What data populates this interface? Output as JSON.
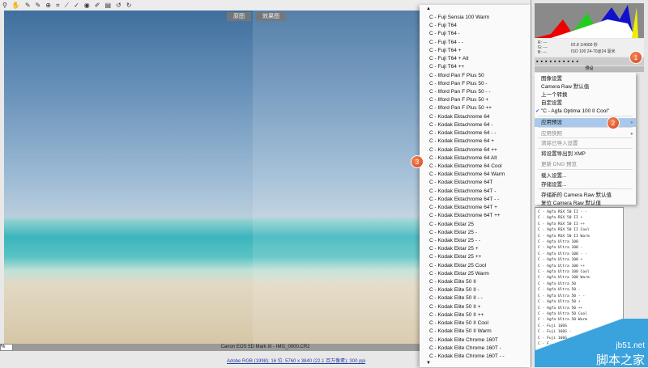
{
  "toolbar": {
    "icons": [
      "zoom-icon",
      "hand-icon",
      "white-balance-icon",
      "color-sampler-icon",
      "target-adjust-icon",
      "crop-icon",
      "straighten-icon",
      "spot-removal-icon",
      "red-eye-icon",
      "adjustment-brush-icon",
      "graduated-filter-icon",
      "rotate-left-icon",
      "rotate-right-icon"
    ]
  },
  "view_buttons": {
    "before": "原图",
    "after": "效果图"
  },
  "bottom": {
    "zoom": "%",
    "camera": "Canon EOS 5D Mark III - IMG_0000.CR2",
    "workflow_link": "Adobe RGB (1998); 16 位; 5760 x 3840 (22.1 百万像素); 300 ppi"
  },
  "info": {
    "r": "R: ---",
    "g": "G: ---",
    "b": "B: ---",
    "exposure": "f/2.8  1/4000 秒",
    "iso": "ISO 100  24-70@24 毫米"
  },
  "presets_header": "预设",
  "menu": {
    "items": [
      {
        "label": "图像设置",
        "disabled": false
      },
      {
        "label": "Camera Raw 默认值",
        "disabled": false
      },
      {
        "label": "上一个转换",
        "disabled": false
      },
      {
        "label": "自定设置",
        "disabled": false
      },
      {
        "label": "\"C - Agfa Optima 100 II Cool\"",
        "disabled": false,
        "checked": true
      },
      {
        "label": "应用预设",
        "highlighted": true,
        "submenu": true
      },
      {
        "label": "应用快照",
        "disabled": true,
        "submenu": true
      },
      {
        "label": "清除已导入设置",
        "disabled": true
      },
      {
        "label": "将设置导出到 XMP",
        "disabled": false
      },
      {
        "label": "更新 DNG 预览",
        "disabled": true
      },
      {
        "label": "载入设置...",
        "disabled": false
      },
      {
        "label": "存储设置...",
        "disabled": false
      },
      {
        "label": "存储新的 Camera Raw 默认值",
        "disabled": false
      },
      {
        "label": "复位 Camera Raw 默认值",
        "disabled": false
      }
    ]
  },
  "preset_list": [
    "C - Agfa RSX 50 II - -",
    "C - Agfa RSX 50 II +",
    "C - Agfa RSX 50 II ++",
    "C - Agfa RSX 50 II Cool",
    "C - Agfa RSX 50 II Warm",
    "C - Agfa Ultra 100",
    "C - Agfa Ultra 100 -",
    "C - Agfa Ultra 100 - -",
    "C - Agfa Ultra 100 +",
    "C - Agfa Ultra 100 ++",
    "C - Agfa Ultra 100 Cool",
    "C - Agfa Ultra 100 Warm",
    "C - Agfa Ultra 50",
    "C - Agfa Ultra 50 -",
    "C - Agfa Ultra 50 - -",
    "C - Agfa Ultra 50 +",
    "C - Agfa Ultra 50 ++",
    "C - Agfa Ultra 50 Cool",
    "C - Agfa Ultra 50 Warm",
    "C - Fuji 160S",
    "C - Fuji 160S -",
    "C - Fuji 160S - -",
    "C - F..."
  ],
  "submenu": [
    "C - Fuji Sensia 100 Warm",
    "C - Fuji T64",
    "C - Fuji T64 -",
    "C - Fuji T64 - -",
    "C - Fuji T64 +",
    "C - Fuji T64 + Alt",
    "C - Fuji T64 ++",
    "C - Ilford Pan F Plus 50",
    "C - Ilford Pan F Plus 50 -",
    "C - Ilford Pan F Plus 50 - -",
    "C - Ilford Pan F Plus 50 +",
    "C - Ilford Pan F Plus 50 ++",
    "C - Kodak Ektachrome 64",
    "C - Kodak Ektachrome 64 -",
    "C - Kodak Ektachrome 64 - -",
    "C - Kodak Ektachrome 64 +",
    "C - Kodak Ektachrome 64 ++",
    "C - Kodak Ektachrome 64 Alt",
    "C - Kodak Ektachrome 64 Cool",
    "C - Kodak Ektachrome 64 Warm",
    "C - Kodak Ektachrome 64T",
    "C - Kodak Ektachrome 64T -",
    "C - Kodak Ektachrome 64T - -",
    "C - Kodak Ektachrome 64T +",
    "C - Kodak Ektachrome 64T ++",
    "C - Kodak Ektar 25",
    "C - Kodak Ektar 25 -",
    "C - Kodak Ektar 25 - -",
    "C - Kodak Ektar 25 +",
    "C - Kodak Ektar 25 ++",
    "C - Kodak Ektar 25 Cool",
    "C - Kodak Ektar 25 Warm",
    "C - Kodak Elite 50 II",
    "C - Kodak Elite 50 II -",
    "C - Kodak Elite 50 II - -",
    "C - Kodak Elite 50 II +",
    "C - Kodak Elite 50 II ++",
    "C - Kodak Elite 50 II Cool",
    "C - Kodak Elite 50 II Warm",
    "C - Kodak Elite Chrome 160T",
    "C - Kodak Elite Chrome 160T -",
    "C - Kodak Elite Chrome 160T - -"
  ],
  "badges": [
    "1",
    "2",
    "3"
  ],
  "watermark": {
    "domain": "jb51.net",
    "name": "脚本之家"
  },
  "colors": {
    "highlight": "#a9c8ec",
    "badge": "#d4411a"
  }
}
